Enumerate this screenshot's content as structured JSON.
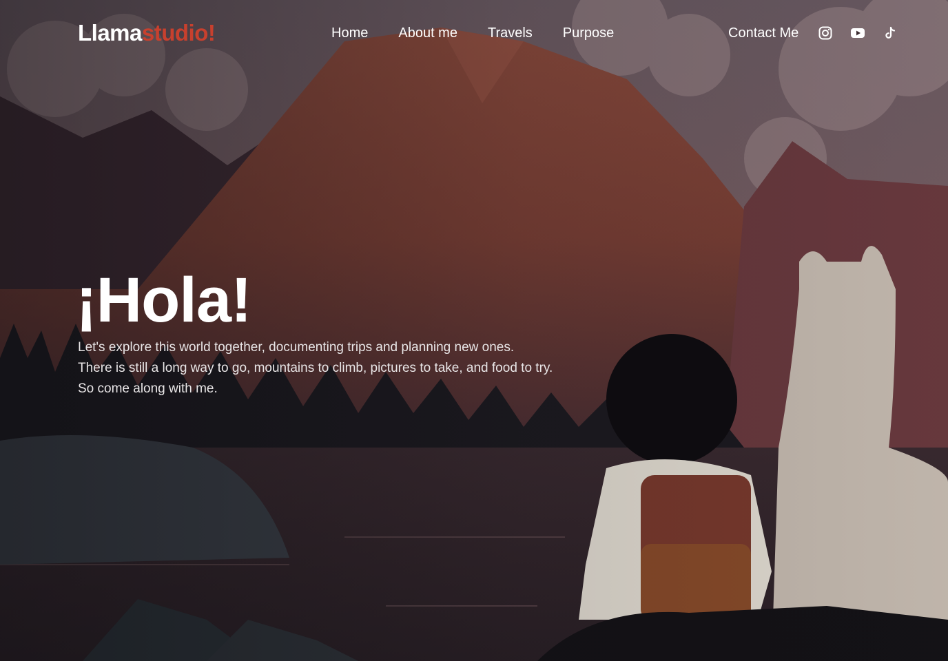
{
  "brand": {
    "part1": "Llama",
    "part2": "studio!"
  },
  "nav": {
    "items": [
      {
        "label": "Home"
      },
      {
        "label": "About me"
      },
      {
        "label": "Travels"
      },
      {
        "label": "Purpose"
      }
    ],
    "contact_label": "Contact Me",
    "socials": [
      "instagram-icon",
      "youtube-icon",
      "tiktok-icon"
    ]
  },
  "hero": {
    "heading": "¡Hola!",
    "lines": [
      "Let's explore this world together, documenting trips and planning new ones.",
      "There is still a long way to go, mountains to climb, pictures to take, and food to try.",
      "So come along with me."
    ]
  },
  "colors": {
    "brand_accent": "#c8402e",
    "text": "#ffffff"
  }
}
